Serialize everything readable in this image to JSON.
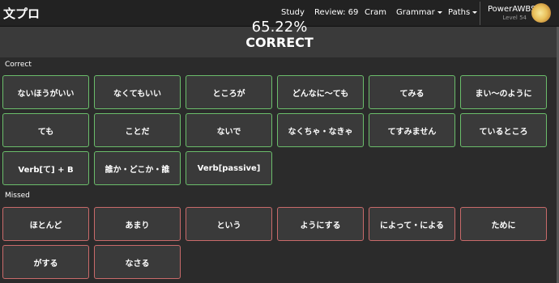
{
  "navbar": {
    "brand": "文プロ",
    "items": [
      {
        "label": "Study",
        "dropdown": false
      },
      {
        "label": "Review: 69",
        "dropdown": false
      },
      {
        "label": "Cram",
        "dropdown": false
      },
      {
        "label": "Grammar",
        "dropdown": true
      },
      {
        "label": "Paths",
        "dropdown": true
      }
    ],
    "user": {
      "name": "PowerAWBS",
      "level": "Level 54"
    }
  },
  "result": {
    "score": "65.22%",
    "status": "CORRECT"
  },
  "sections": {
    "correct_label": "Correct",
    "missed_label": "Missed",
    "correct": [
      "ないほうがいい",
      "なくてもいい",
      "ところが",
      "どんなに〜ても",
      "てみる",
      "まい〜のように",
      "ても",
      "ことだ",
      "ないで",
      "なくちゃ・なきゃ",
      "てすみません",
      "ているところ",
      "Verb[て] + B",
      "誰か・どこか・誰",
      "Verb[passive]"
    ],
    "missed": [
      "ほとんど",
      "あまり",
      "という",
      "ようにする",
      "によって・による",
      "ために",
      "がする",
      "なさる"
    ]
  },
  "colors": {
    "correct_border": "#6bbd6b",
    "missed_border": "#c96a6a",
    "navbar_bg": "#222222",
    "panel_bg": "#2b2b2b"
  }
}
